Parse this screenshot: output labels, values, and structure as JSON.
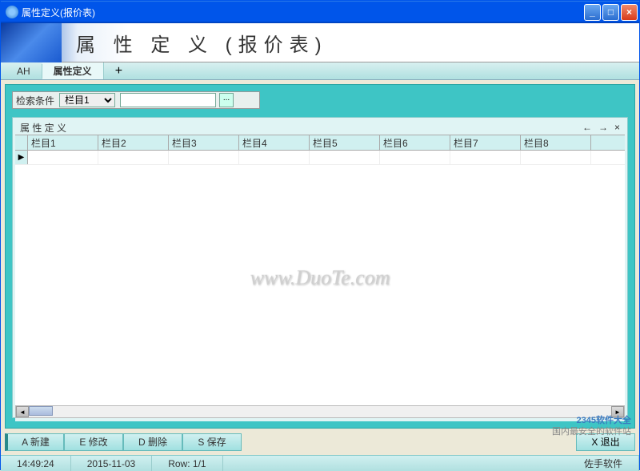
{
  "window": {
    "title": "属性定义(报价表)"
  },
  "banner": {
    "title": "属 性 定 义 (报价表)"
  },
  "tabs": {
    "items": [
      "AH",
      "属性定义"
    ],
    "active_index": 1,
    "add": "+"
  },
  "search": {
    "label": "检索条件",
    "selected": "栏目1",
    "options": [
      "栏目1",
      "栏目2",
      "栏目3",
      "栏目4",
      "栏目5",
      "栏目6",
      "栏目7",
      "栏目8"
    ],
    "value": "",
    "browse": "..."
  },
  "grid": {
    "title": "属 性 定 义",
    "nav_prev": "←",
    "nav_next": "→",
    "nav_close": "×",
    "columns": [
      "栏目1",
      "栏目2",
      "栏目3",
      "栏目4",
      "栏目5",
      "栏目6",
      "栏目7",
      "栏目8"
    ],
    "row_marker": "▶",
    "rows": [
      [
        "",
        "",
        "",
        "",
        "",
        "",
        "",
        ""
      ]
    ]
  },
  "watermark": "www.DuoTe.com",
  "toolbar": {
    "new": "A 新建",
    "edit": "E 修改",
    "delete": "D 删除",
    "save": "S 保存",
    "exit": "X 退出"
  },
  "status": {
    "time": "14:49:24",
    "date": "2015-11-03",
    "row": "Row: 1/1",
    "brand": "佐手软件"
  },
  "corner_watermark": {
    "line1": "2345软件大全",
    "line2": "国内最安全的软件站"
  },
  "colors": {
    "teal": "#3ec5c5"
  }
}
